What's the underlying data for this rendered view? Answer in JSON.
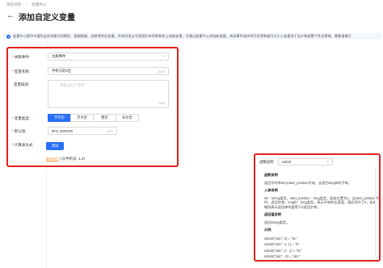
{
  "breadcrumb": [
    "风险识别",
    "变量中心"
  ],
  "page": {
    "title": "添加自定义变量"
  },
  "notice": {
    "text": "变量中心提供丰富的业务场景识别模型、基础数据、函数等特征变量，并有阿里云专家团队持续更新和上线新变量，可通过变量中心添加新变量，关闭事件或技术开发等数据可以引入变量用于设计和配置个性化策略，需要请填写"
  },
  "form": {
    "event_label": "关联事件:",
    "event_value": "注册事件",
    "name_label": "变量名称:",
    "name_value": "手机号前3位",
    "name_count": "6/32",
    "desc_label": "变量描述:",
    "desc_placeholder": "不超过64个字符",
    "desc_count": "0/64",
    "type_label": "变量类型:",
    "types": [
      "字符型",
      "浮点型",
      "整型",
      "布尔型"
    ],
    "default_label": "默认值:",
    "default_value": "$YS_ERROR",
    "default_count": "9/20",
    "calc_label": "计算表达式:",
    "test_label": "测试",
    "formula_fn": "$substr",
    "formula_rest": "( @手机号 ,1,3)"
  },
  "help": {
    "label": "函数说明",
    "select_value": "substr",
    "desc_title": "函数说明",
    "desc_text": "返回字符串str从start_position开始、长度为length的子串。",
    "params_title": "入参说明",
    "params_text": "str：string类型。start_position：long类型，起始位置为1，当start_position为时，返回空串。length：long类型，表示子串的长度值，值必须大于0，若省略则表示返回串的值等于0返回空串。",
    "return_title": "返回值说明",
    "return_text": "返回string类型。",
    "example_title": "示例",
    "examples": [
      "substr(\"abc\", 2) = \"bc\"",
      "substr(\"abc\", 2, 1) = \"b\"",
      "substr(\"abc\",-2 , 2) = \"bc\"",
      "substr(\"abc\", -3) = \"abc\""
    ]
  }
}
